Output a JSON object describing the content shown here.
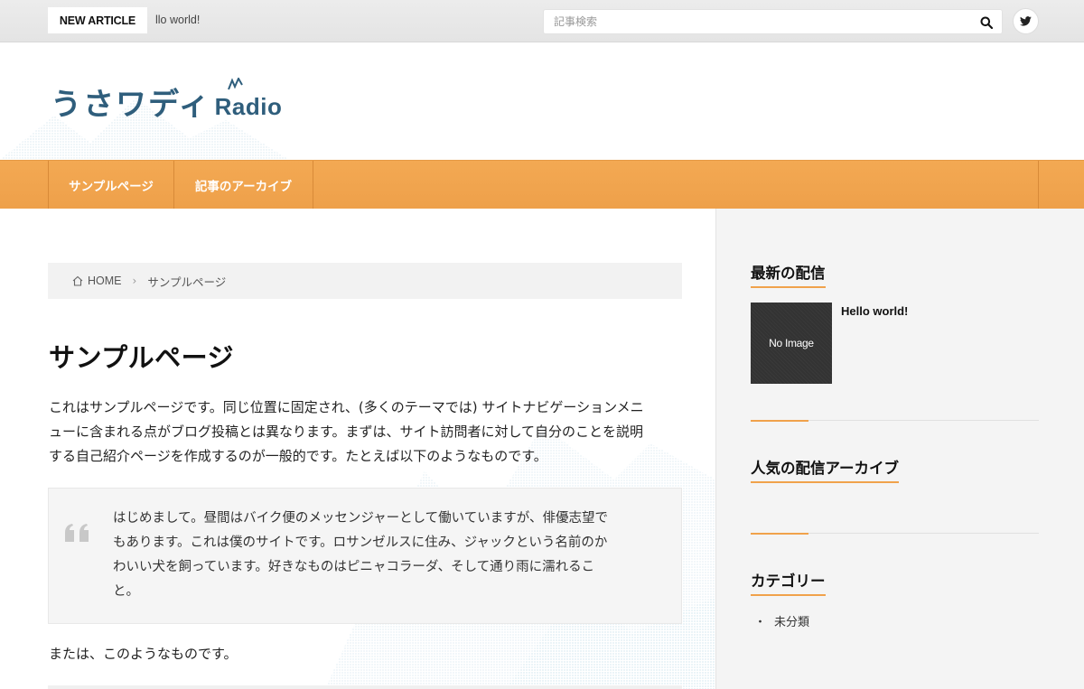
{
  "topbar": {
    "new_article_label": "NEW ARTICLE",
    "ticker_text": "llo world!",
    "search_placeholder": "記事検索"
  },
  "header": {
    "logo_jp": "うさワディ",
    "logo_en": "Radio"
  },
  "nav": {
    "items": [
      {
        "label": "サンプルページ"
      },
      {
        "label": "記事のアーカイブ"
      }
    ]
  },
  "breadcrumb": {
    "home": "HOME",
    "current": "サンプルページ"
  },
  "main": {
    "title": "サンプルページ",
    "intro_lines": [
      "これはサンプルページです。同じ位置に固定され、(多くのテーマでは) サイトナビゲーションメニ",
      "ューに含まれる点がブログ投稿とは異なります。まずは、サイト訪問者に対して自分のことを説明",
      "する自己紹介ページを作成するのが一般的です。たとえば以下のようなものです。"
    ],
    "quote_lines": [
      "はじめまして。昼間はバイク便のメッセンジャーとして働いていますが、俳優志望で",
      "もあります。これは僕のサイトです。ロサンゼルスに住み、ジャックという名前のか",
      "わいい犬を飼っています。好きなものはピニャコラーダ、そして通り雨に濡れるこ",
      "と。"
    ],
    "outro": "または、このようなものです。"
  },
  "sidebar": {
    "latest_title": "最新の配信",
    "latest_post": {
      "thumbnail_label": "No Image",
      "title": "Hello world!"
    },
    "popular_title": "人気の配信アーカイブ",
    "category_title": "カテゴリー",
    "categories": [
      {
        "bullet": "・",
        "label": "未分類"
      }
    ]
  },
  "colors": {
    "accent": "#f0a24b",
    "nav_bg": "#f3a953",
    "logo": "#2f5e7c"
  },
  "icons": {
    "search": "search-icon",
    "twitter": "twitter-icon",
    "home": "home-icon",
    "quote": "quote-icon",
    "chevron": "chevron-right-icon"
  }
}
